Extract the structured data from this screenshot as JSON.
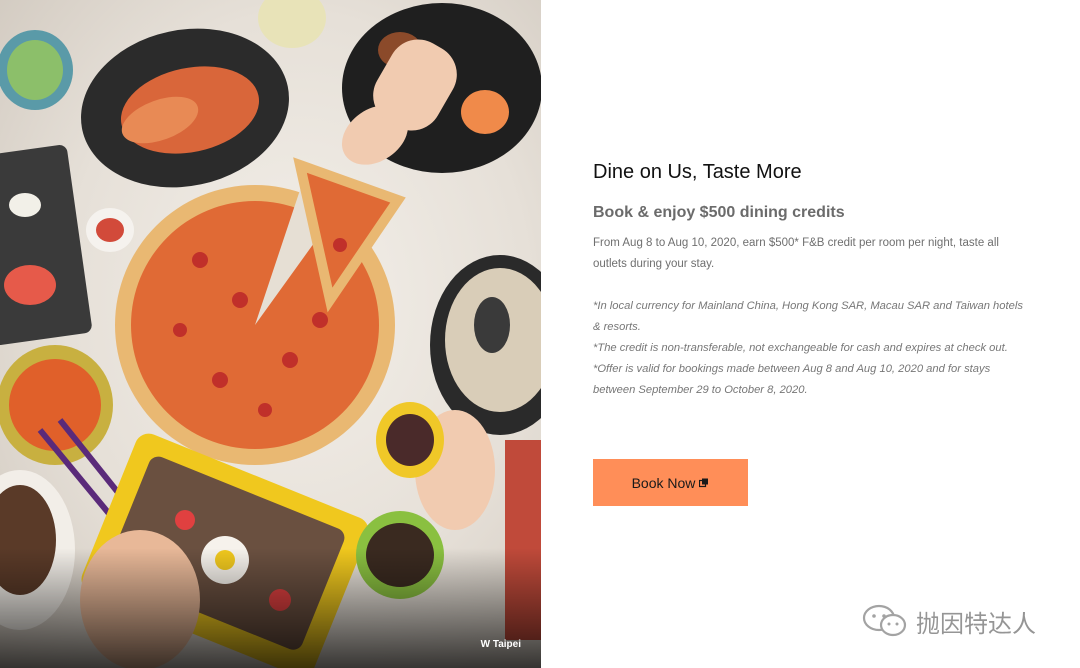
{
  "photo": {
    "caption": "W Taipei",
    "icon": "food-photo"
  },
  "content": {
    "headline": "Dine on Us, Taste More",
    "subheadline": "Book & enjoy $500 dining credits",
    "description": "From Aug 8 to Aug 10, 2020, earn $500* F&B credit per room per night, taste all outlets during your stay.",
    "notes": [
      "*In local currency for Mainland China, Hong Kong SAR, Macau SAR and Taiwan hotels & resorts.",
      "*The credit is non-transferable, not exchangeable for cash and expires at check out.",
      "*Offer is valid for bookings made between Aug 8 and Aug 10, 2020 and for stays between September 29 to October 8, 2020."
    ]
  },
  "cta": {
    "label": "Book Now",
    "icon": "external-link-icon",
    "color": "#ff8e58"
  },
  "watermark": {
    "text": "抛因特达人",
    "icon": "wechat-icon"
  }
}
